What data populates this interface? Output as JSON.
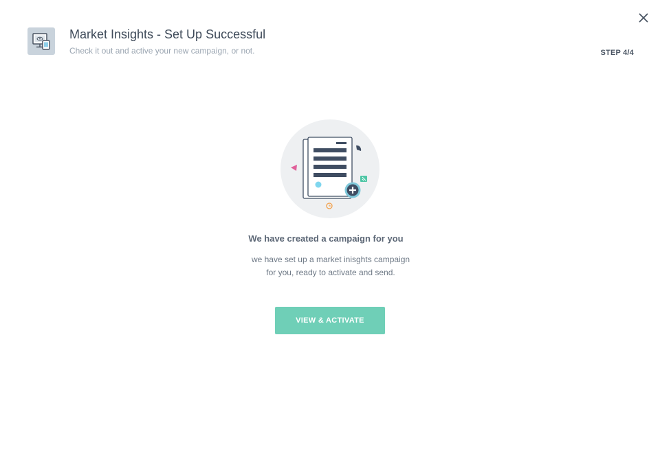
{
  "header": {
    "icon": "device-monitor-icon",
    "title": "Market Insights - Set Up Successful",
    "subtitle": "Check it out and active your new campaign, or not.",
    "step": "STEP 4/4",
    "close_icon": "close-icon"
  },
  "main": {
    "illustration": "campaign-document-icon",
    "heading": "We have created a campaign for you",
    "description_lines": [
      "we have set up a market inisghts campaign",
      "for you, ready to activate and send."
    ],
    "cta_label": "VIEW & ACTIVATE"
  },
  "colors": {
    "accent": "#6fcfb7",
    "title": "#3e4a59",
    "muted": "#9aa5b1",
    "illustration_bg": "#eef0f2",
    "pink": "#e0609a",
    "orange": "#f2a04a",
    "cyan": "#7fd6ee",
    "dark_slate": "#3f4d62"
  }
}
